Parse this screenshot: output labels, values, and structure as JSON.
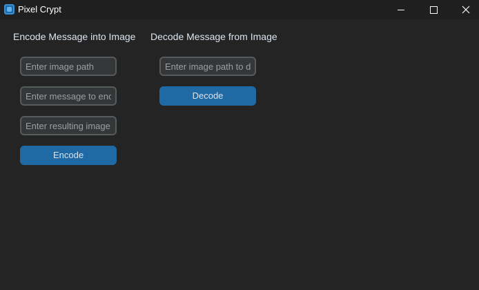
{
  "window": {
    "title": "Pixel Crypt",
    "icon": "app-logo-icon",
    "controls": [
      "minimize-icon",
      "maximize-icon",
      "close-icon"
    ]
  },
  "encode": {
    "heading": "Encode Message into Image",
    "image_path_placeholder": "Enter image path",
    "message_placeholder": "Enter message to encode",
    "output_path_placeholder": "Enter resulting image path",
    "button_label": "Encode"
  },
  "decode": {
    "heading": "Decode Message from Image",
    "image_path_placeholder": "Enter image path to decode",
    "button_label": "Decode"
  },
  "colors": {
    "background": "#242424",
    "titlebar": "#1f1f1f",
    "field_bg": "#343638",
    "field_border": "#565b5e",
    "button": "#1f6aa5",
    "text": "#dce4ee"
  }
}
